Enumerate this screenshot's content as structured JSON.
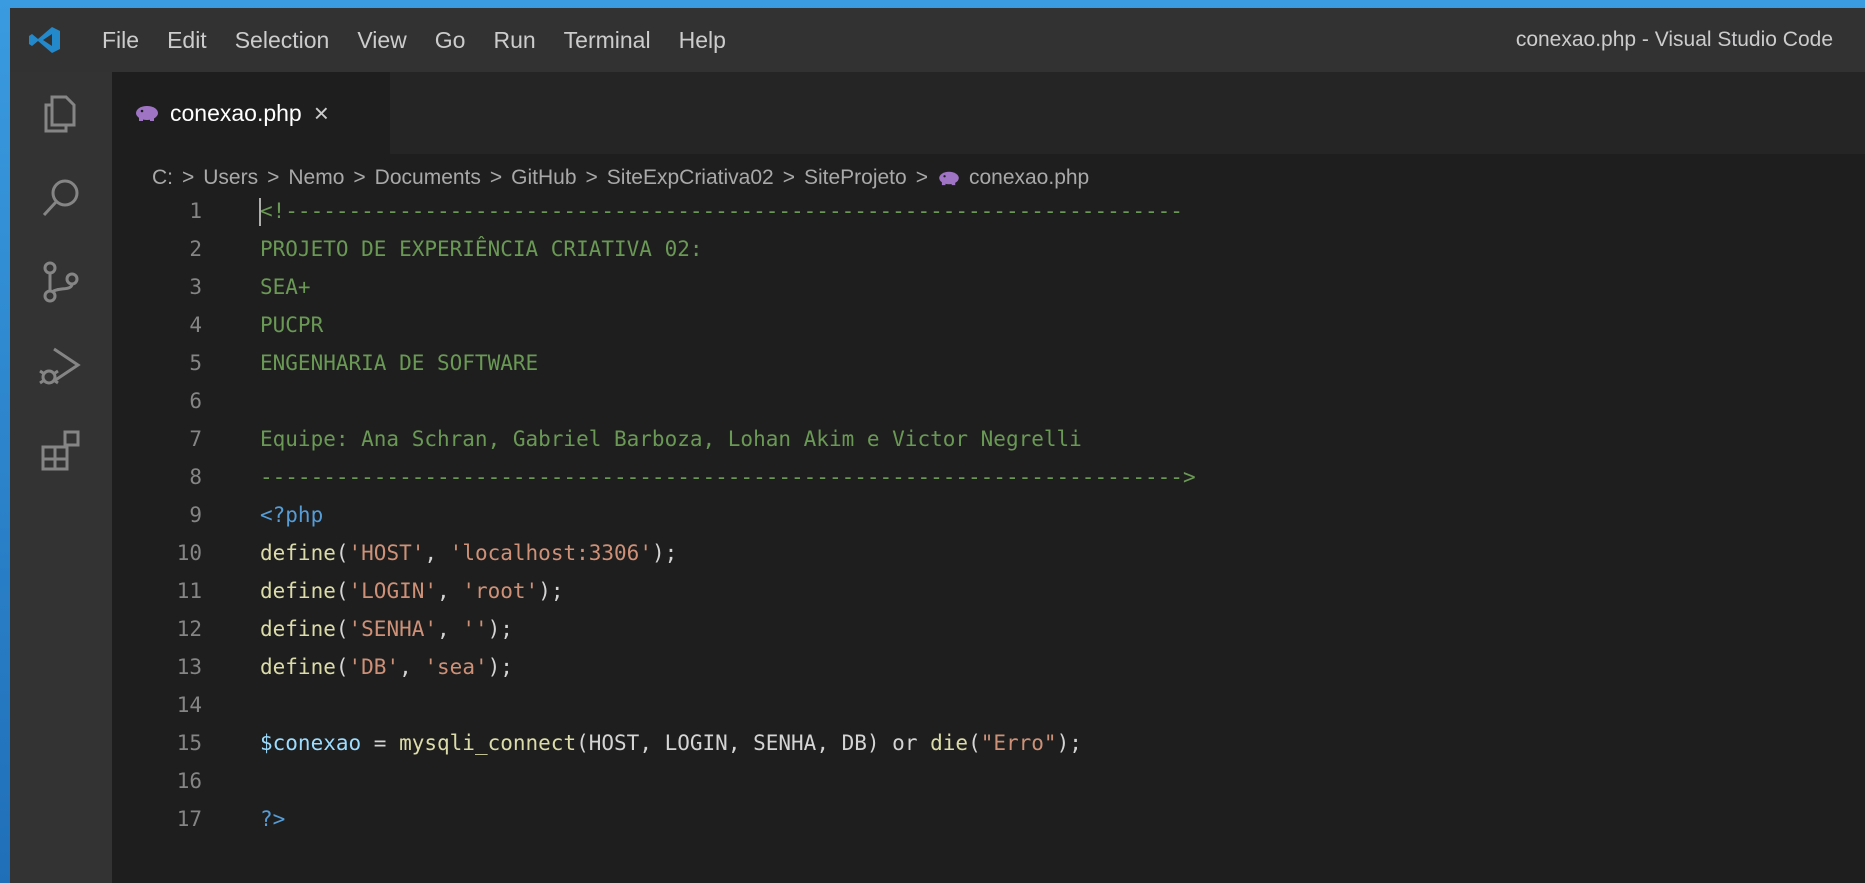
{
  "window": {
    "title": "conexao.php - Visual Studio Code"
  },
  "menu": [
    "File",
    "Edit",
    "Selection",
    "View",
    "Go",
    "Run",
    "Terminal",
    "Help"
  ],
  "activity_bar": [
    "explorer-icon",
    "search-icon",
    "source-control-icon",
    "run-debug-icon",
    "extensions-icon"
  ],
  "tab": {
    "label": "conexao.php",
    "close": "×"
  },
  "breadcrumb": {
    "items": [
      "C:",
      "Users",
      "Nemo",
      "Documents",
      "GitHub",
      "SiteExpCriativa02",
      "SiteProjeto"
    ],
    "file": "conexao.php",
    "separator": ">"
  },
  "editor": {
    "lines": [
      [
        {
          "t": "<!-----------------------------------------------------------------------",
          "c": "comment"
        }
      ],
      [
        {
          "t": "PROJETO DE EXPERIÊNCIA CRIATIVA 02:",
          "c": "comment"
        }
      ],
      [
        {
          "t": "SEA+",
          "c": "comment"
        }
      ],
      [
        {
          "t": "PUCPR",
          "c": "comment"
        }
      ],
      [
        {
          "t": "ENGENHARIA DE SOFTWARE",
          "c": "comment"
        }
      ],
      [
        {
          "t": "",
          "c": "plain"
        }
      ],
      [
        {
          "t": "Equipe: Ana Schran, Gabriel Barboza, Lohan Akim e Victor Negrelli",
          "c": "comment"
        }
      ],
      [
        {
          "t": "------------------------------------------------------------------------->",
          "c": "comment"
        }
      ],
      [
        {
          "t": "<?php",
          "c": "tag"
        }
      ],
      [
        {
          "t": "define",
          "c": "fn"
        },
        {
          "t": "(",
          "c": "plain"
        },
        {
          "t": "'HOST'",
          "c": "str"
        },
        {
          "t": ", ",
          "c": "plain"
        },
        {
          "t": "'localhost:3306'",
          "c": "str"
        },
        {
          "t": ");",
          "c": "plain"
        }
      ],
      [
        {
          "t": "define",
          "c": "fn"
        },
        {
          "t": "(",
          "c": "plain"
        },
        {
          "t": "'LOGIN'",
          "c": "str"
        },
        {
          "t": ", ",
          "c": "plain"
        },
        {
          "t": "'root'",
          "c": "str"
        },
        {
          "t": ");",
          "c": "plain"
        }
      ],
      [
        {
          "t": "define",
          "c": "fn"
        },
        {
          "t": "(",
          "c": "plain"
        },
        {
          "t": "'SENHA'",
          "c": "str"
        },
        {
          "t": ", ",
          "c": "plain"
        },
        {
          "t": "''",
          "c": "str"
        },
        {
          "t": ");",
          "c": "plain"
        }
      ],
      [
        {
          "t": "define",
          "c": "fn"
        },
        {
          "t": "(",
          "c": "plain"
        },
        {
          "t": "'DB'",
          "c": "str"
        },
        {
          "t": ", ",
          "c": "plain"
        },
        {
          "t": "'sea'",
          "c": "str"
        },
        {
          "t": ");",
          "c": "plain"
        }
      ],
      [
        {
          "t": "",
          "c": "plain"
        }
      ],
      [
        {
          "t": "$conexao",
          "c": "var"
        },
        {
          "t": " = ",
          "c": "plain"
        },
        {
          "t": "mysqli_connect",
          "c": "fn"
        },
        {
          "t": "(HOST, LOGIN, SENHA, DB) or ",
          "c": "plain"
        },
        {
          "t": "die",
          "c": "fn"
        },
        {
          "t": "(",
          "c": "plain"
        },
        {
          "t": "\"Erro\"",
          "c": "str"
        },
        {
          "t": ");",
          "c": "plain"
        }
      ],
      [
        {
          "t": "",
          "c": "plain"
        }
      ],
      [
        {
          "t": "?>",
          "c": "tag"
        }
      ]
    ]
  },
  "colors": {
    "comment": "#6a9955",
    "keyword": "#569cd6",
    "function": "#dcdcaa",
    "string": "#ce9178",
    "variable": "#9cdcfe",
    "php_icon": "#a074c4"
  }
}
